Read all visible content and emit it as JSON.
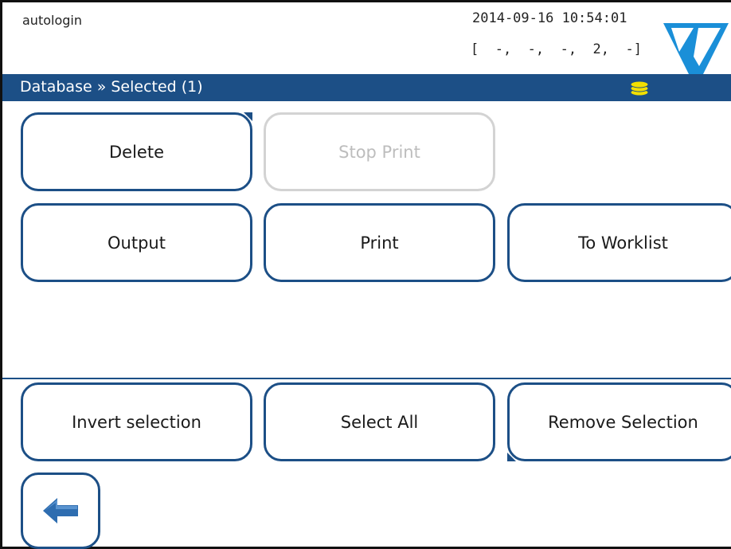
{
  "header": {
    "user": "autologin",
    "datetime": "2014-09-16 10:54:01",
    "status": "[  -,  -,  -,  2,  -]"
  },
  "titlebar": {
    "title": "Database » Selected (1)"
  },
  "buttons": {
    "delete": "Delete",
    "stop_print": "Stop Print",
    "output": "Output",
    "print": "Print",
    "to_worklist": "To Worklist",
    "invert_selection": "Invert selection",
    "select_all": "Select All",
    "remove_selection": "Remove Selection"
  },
  "icons": {
    "logo": "brand-logo-icon",
    "database": "database-icon",
    "back": "back-arrow-icon"
  },
  "colors": {
    "accent": "#1c4f86",
    "database_icon": "#f2df00",
    "disabled": "#d3d3d3"
  }
}
